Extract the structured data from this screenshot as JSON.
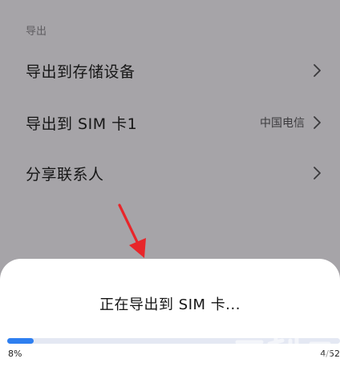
{
  "section": {
    "header": "导出"
  },
  "menu": {
    "items": [
      {
        "label": "导出到存储设备",
        "value": ""
      },
      {
        "label": "导出到 SIM 卡1",
        "value": "中国电信"
      },
      {
        "label": "分享联系人",
        "value": ""
      }
    ]
  },
  "icons": {
    "row_chevron": "chevron-right-icon",
    "annotation": "red-arrow-down-icon",
    "watermark": "watermark-logo"
  },
  "colors": {
    "annotation_arrow": "#e8262a",
    "progress_fill": "#2e7ff0",
    "progress_track": "#e4e8f3"
  },
  "dialog": {
    "title": "正在导出到 SIM 卡...",
    "progress_fraction": 0.08,
    "percent_label": "8%",
    "count_label": "4/52"
  }
}
